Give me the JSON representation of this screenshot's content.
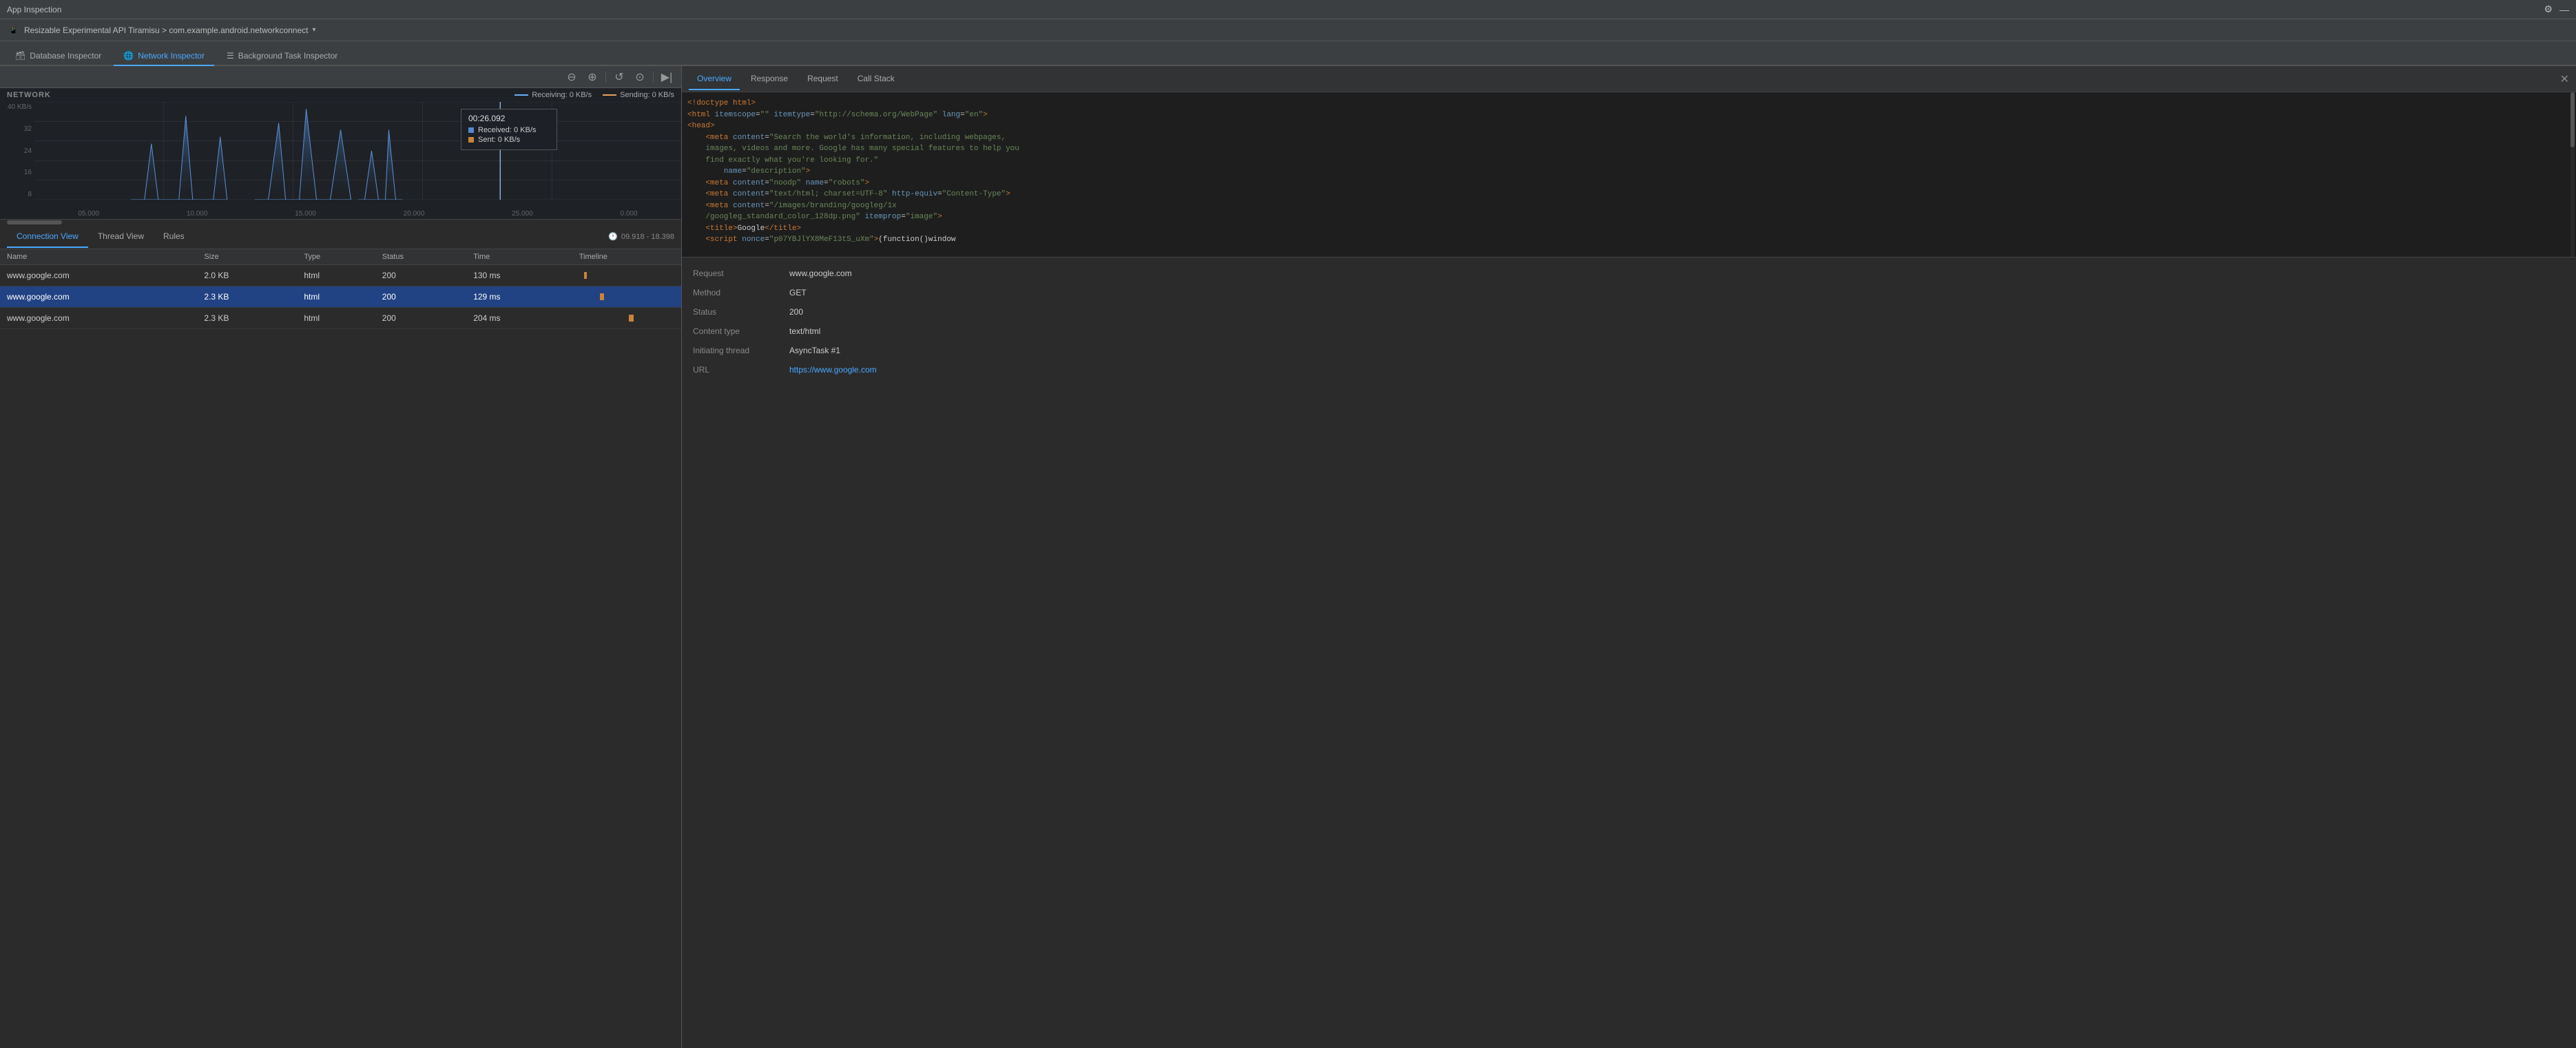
{
  "titleBar": {
    "title": "App Inspection",
    "settingsIcon": "⚙",
    "minimizeIcon": "—"
  },
  "deviceBar": {
    "deviceName": "Resizable Experimental API Tiramisu > com.example.android.networkconnect",
    "chevron": "▾"
  },
  "tabs": [
    {
      "id": "db",
      "label": "Database Inspector",
      "icon": "🗃",
      "active": false
    },
    {
      "id": "network",
      "label": "Network Inspector",
      "icon": "🌐",
      "active": true
    },
    {
      "id": "bg",
      "label": "Background Task Inspector",
      "icon": "☰",
      "active": false
    }
  ],
  "toolbar": {
    "zoomOutIcon": "zoom-out",
    "zoomInIcon": "zoom-in",
    "resetIcon": "reset",
    "settingsIcon": "settings",
    "recordIcon": "record"
  },
  "networkGraph": {
    "title": "NETWORK",
    "yLabels": [
      "40 KB/s",
      "32",
      "24",
      "16",
      "8"
    ],
    "xLabels": [
      "05.000",
      "10.000",
      "15.000",
      "20.000",
      "25.000",
      "0.000"
    ],
    "legend": {
      "receivingLabel": "Receiving: 0 KB/s",
      "sendingLabel": "Sending: 0 KB/s"
    },
    "tooltip": {
      "time": "00:26.092",
      "received": "Received: 0 KB/s",
      "sent": "Sent: 0 KB/s"
    }
  },
  "connectionTabs": [
    {
      "id": "connection",
      "label": "Connection View",
      "active": true
    },
    {
      "id": "thread",
      "label": "Thread View",
      "active": false
    },
    {
      "id": "rules",
      "label": "Rules",
      "active": false
    }
  ],
  "timeRange": "09.918 - 18.398",
  "tableHeaders": [
    "Name",
    "Size",
    "Type",
    "Status",
    "Time",
    "Timeline"
  ],
  "tableRows": [
    {
      "name": "www.google.com",
      "size": "2.0 KB",
      "type": "html",
      "status": "200",
      "time": "130 ms",
      "timelineOffset": 5,
      "timelineWidth": 3,
      "selected": false
    },
    {
      "name": "www.google.com",
      "size": "2.3 KB",
      "type": "html",
      "status": "200",
      "time": "129 ms",
      "timelineOffset": 22,
      "timelineWidth": 4,
      "selected": true
    },
    {
      "name": "www.google.com",
      "size": "2.3 KB",
      "type": "html",
      "status": "200",
      "time": "204 ms",
      "timelineOffset": 52,
      "timelineWidth": 5,
      "selected": false
    }
  ],
  "rightPanel": {
    "tabs": [
      {
        "id": "overview",
        "label": "Overview",
        "active": true
      },
      {
        "id": "response",
        "label": "Response",
        "active": false
      },
      {
        "id": "request",
        "label": "Request",
        "active": false
      },
      {
        "id": "callstack",
        "label": "Call Stack",
        "active": false
      }
    ],
    "codeContent": [
      "<!doctype html>",
      "<html itemscope=\"\" itemtype=\"http://schema.org/WebPage\" lang=\"en\">",
      "<head>",
      "    <meta content=\"Search the world's information, including webpages,",
      "    images, videos and more. Google has many special features to help you",
      "    find exactly what you're looking for.\"",
      "        name=\"description\">",
      "    <meta content=\"noodp\" name=\"robots\">",
      "    <meta content=\"text/html; charset=UTF-8\" http-equiv=\"Content-Type\">",
      "    <meta content=\"/images/branding/googleg/1x",
      "    /googleg_standard_color_128dp.png\" itemprop=\"image\">",
      "    <title>Google</title>",
      "    <script nonce=\"p07YBJlYX8MeF13tS_uXm\">(function()window"
    ],
    "details": {
      "request": {
        "label": "Request",
        "value": "www.google.com"
      },
      "method": {
        "label": "Method",
        "value": "GET"
      },
      "status": {
        "label": "Status",
        "value": "200"
      },
      "contentType": {
        "label": "Content type",
        "value": "text/html"
      },
      "initiatingThread": {
        "label": "Initiating thread",
        "value": "AsyncTask #1"
      },
      "url": {
        "label": "URL",
        "value": "https://www.google.com",
        "isLink": true
      }
    }
  }
}
